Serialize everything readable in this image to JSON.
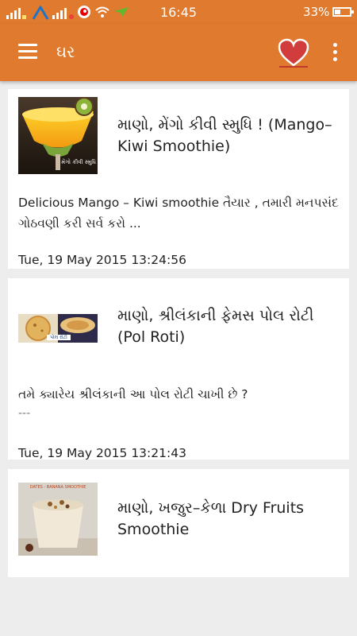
{
  "status_bar": {
    "time": "16:45",
    "battery": "33%",
    "battery_level": 0.33
  },
  "app_bar": {
    "title": "ઘર",
    "menu_icon": "hamburger-icon",
    "favorite_icon": "heart-icon",
    "overflow_icon": "more-vert-icon"
  },
  "colors": {
    "primary": "#e07a2e",
    "favorite": "#d13c3c",
    "background": "#ededed"
  },
  "posts": [
    {
      "title": "માણો, મેંગો કીવી સ્મુધિ ! (Mango–Kiwi Smoothie)",
      "image_caption": "મેંગો કીવી સ્મુધિ",
      "description": "Delicious Mango – Kiwi smoothie તૈયાર , તમારી મનપસંદ ગોઠવણી કરી સર્વ કરો ...",
      "date": "Tue, 19 May 2015 13:24:56"
    },
    {
      "title": "માણો, શ્રીલંકાની ફેમસ પોલ રોટી (Pol Roti)",
      "image_caption": "પોલ રોટી",
      "description": "તમે ક્યારેય શ્રીલંકાની આ પોલ રોટી ચાખી છે ?",
      "more": "---",
      "date": "Tue, 19 May 2015 13:21:43"
    },
    {
      "title": "માણો, ખજુર–કેળા Dry Fruits Smoothie",
      "image_caption": "DATES - BANANA SMOOTHIE"
    }
  ]
}
